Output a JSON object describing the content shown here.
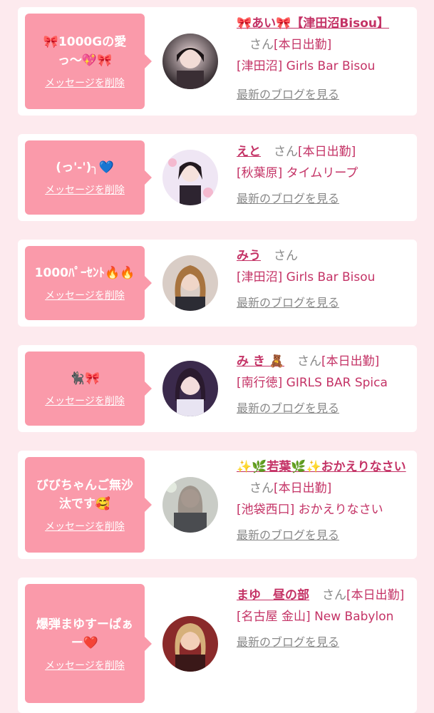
{
  "entries": [
    {
      "message": "🎀1000Gの愛\nっ〜💖🎀",
      "delete_label": "メッセージを削除",
      "name": "🎀あい🎀【津田沼Bisou】",
      "honorific": "さん",
      "status": "[本日出勤]",
      "shop": "[津田沼] Girls Bar Bisou",
      "blog_label": "最新のブログを見る",
      "avatar_icon": "profile-photo"
    },
    {
      "message": "(っ'-')╮💙",
      "delete_label": "メッセージを削除",
      "name": "えと",
      "honorific": "さん",
      "status": "[本日出勤]",
      "shop": "[秋葉原] タイムリープ",
      "blog_label": "最新のブログを見る",
      "avatar_icon": "profile-photo"
    },
    {
      "message": "1000ﾊﾟｰｾﾝﾄ🔥🔥",
      "delete_label": "メッセージを削除",
      "name": "みう",
      "honorific": "さん",
      "status": "",
      "shop": "[津田沼] Girls Bar Bisou",
      "blog_label": "最新のブログを見る",
      "avatar_icon": "profile-photo"
    },
    {
      "message": "🐈‍⬛🎀",
      "delete_label": "メッセージを削除",
      "name": "み き 🧸",
      "honorific": "さん",
      "status": "[本日出勤]",
      "shop": "[南行徳] GIRLS BAR Spica",
      "blog_label": "最新のブログを見る",
      "avatar_icon": "profile-photo"
    },
    {
      "message": "びびちゃんご無沙\n汰です🥰",
      "delete_label": "メッセージを削除",
      "name": "✨🌿若葉🌿✨おかえりなさい",
      "honorific": "さん",
      "status": "[本日出勤]",
      "shop": "[池袋西口] おかえりなさい",
      "blog_label": "最新のブログを見る",
      "avatar_icon": "profile-photo"
    },
    {
      "message": "爆弾まゆすーぱぁ\nー❤️",
      "delete_label": "メッセージを削除",
      "name": "まゆ　昼の部",
      "honorific": "さん",
      "status": "[本日出勤]",
      "shop": "[名古屋 金山] New Babylon",
      "blog_label": "最新のブログを見る",
      "avatar_icon": "profile-photo"
    }
  ],
  "colors": {
    "background": "#fdeaee",
    "bubble": "#fa9aaa",
    "accent": "#c43366",
    "muted": "#888888"
  }
}
